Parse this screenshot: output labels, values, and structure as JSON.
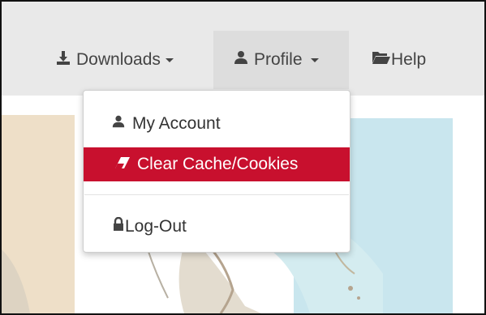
{
  "nav": {
    "downloads_label": "Downloads",
    "profile_label": "Profile",
    "help_label": "Help"
  },
  "menu": {
    "my_account": "My Account",
    "clear_cache": "Clear Cache/Cookies",
    "logout": "Log-Out"
  },
  "icons": {
    "downloads": "download-icon",
    "profile": "user-icon",
    "help": "folder-open-icon",
    "my_account": "user-icon",
    "clear_cache": "eraser-icon",
    "logout": "lock-icon"
  },
  "colors": {
    "navbar_bg": "#e9e9e9",
    "active_bg": "#dddddd",
    "highlight": "#c8102e",
    "text": "#444444"
  }
}
